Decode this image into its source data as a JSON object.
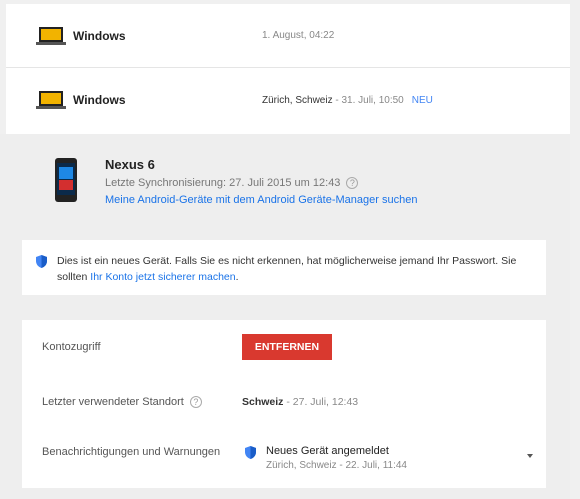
{
  "devices": [
    {
      "name": "Windows",
      "meta": "1. August, 04:22"
    },
    {
      "name": "Windows",
      "location": "Zürich, Schweiz",
      "meta": " - 31. Juli, 10:50",
      "badge": "NEU"
    }
  ],
  "selected_device": {
    "name": "Nexus 6",
    "sync": "Letzte Synchronisierung: 27. Juli 2015 um 12:43",
    "help": "?",
    "manager_link": "Meine Android-Geräte mit dem Android Geräte-Manager suchen"
  },
  "warning": {
    "text": "Dies ist ein neues Gerät. Falls Sie es nicht erkennen, hat möglicherweise jemand Ihr Passwort. Sie sollten ",
    "link": "Ihr Konto jetzt sicherer machen",
    "end": "."
  },
  "settings": {
    "account_access_label": "Kontozugriff",
    "remove_button": "ENTFERNEN",
    "last_location_label": "Letzter verwendeter Standort",
    "last_location_value": "Schweiz",
    "last_location_date": " - 27. Juli, 12:43",
    "notifications_label": "Benachrichtigungen und Warnungen",
    "notification_title": "Neues Gerät angemeldet",
    "notification_sub": "Zürich, Schweiz - 22. Juli, 11:44"
  },
  "colors": {
    "accent": "#4285f4",
    "danger": "#d9392f",
    "laptop": "#f2b300"
  }
}
